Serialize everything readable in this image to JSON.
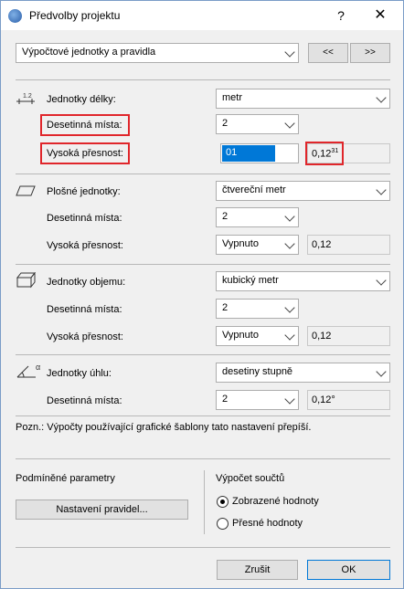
{
  "window": {
    "title": "Předvolby projektu",
    "help": "?",
    "close": "✕"
  },
  "header": {
    "page_select": "Výpočtové jednotky a pravidla",
    "prev": "<<",
    "next": ">>"
  },
  "length": {
    "label": "Jednotky délky:",
    "unit": "metr",
    "decimals_label": "Desetinná místa:",
    "decimals": "2",
    "precision_label": "Vysoká přesnost:",
    "precision": "01",
    "preview": "0,12",
    "preview_sup": "31"
  },
  "area": {
    "label": "Plošné jednotky:",
    "unit": "čtvereční metr",
    "decimals_label": "Desetinná místa:",
    "decimals": "2",
    "precision_label": "Vysoká přesnost:",
    "precision": "Vypnuto",
    "preview": "0,12"
  },
  "volume": {
    "label": "Jednotky objemu:",
    "unit": "kubický metr",
    "decimals_label": "Desetinná místa:",
    "decimals": "2",
    "precision_label": "Vysoká přesnost:",
    "precision": "Vypnuto",
    "preview": "0,12"
  },
  "angle": {
    "label": "Jednotky úhlu:",
    "unit": "desetiny stupně",
    "decimals_label": "Desetinná místa:",
    "decimals": "2",
    "preview": "0,12°"
  },
  "note": "Pozn.: Výpočty používající grafické šablony tato nastavení přepíší.",
  "conditional": {
    "title": "Podmíněné parametry",
    "button": "Nastavení pravidel..."
  },
  "totals": {
    "title": "Výpočet součtů",
    "options": [
      "Zobrazené hodnoty",
      "Přesné hodnoty"
    ],
    "selected": 0
  },
  "footer": {
    "cancel": "Zrušit",
    "ok": "OK"
  },
  "colors": {
    "highlight": "#0078d7",
    "annotation": "#e0262b"
  }
}
